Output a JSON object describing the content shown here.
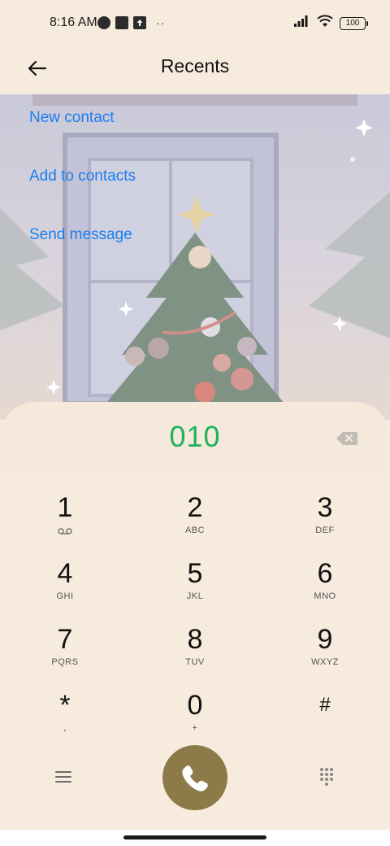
{
  "status_bar": {
    "time": "8:16 AM",
    "dots": "··",
    "battery": "100",
    "icons": [
      "app-icon",
      "notification-square-icon",
      "upload-icon",
      "signal-icon",
      "wifi-icon",
      "battery-icon"
    ]
  },
  "header": {
    "title": "Recents",
    "back_icon": "arrow-left-icon"
  },
  "actions": {
    "new_contact": "New contact",
    "add_to_contacts": "Add to contacts",
    "send_message": "Send message"
  },
  "dialer": {
    "number": "010",
    "delete_icon": "backspace-icon",
    "keys": [
      {
        "digit": "1",
        "letters": ""
      },
      {
        "digit": "2",
        "letters": "ABC"
      },
      {
        "digit": "3",
        "letters": "DEF"
      },
      {
        "digit": "4",
        "letters": "GHI"
      },
      {
        "digit": "5",
        "letters": "JKL"
      },
      {
        "digit": "6",
        "letters": "MNO"
      },
      {
        "digit": "7",
        "letters": "PQRS"
      },
      {
        "digit": "8",
        "letters": "TUV"
      },
      {
        "digit": "9",
        "letters": "WXYZ"
      },
      {
        "digit": "*",
        "letters": ","
      },
      {
        "digit": "0",
        "letters": "+"
      },
      {
        "digit": "#",
        "letters": ""
      }
    ],
    "call_icon": "phone-icon",
    "menu_icon": "menu-icon",
    "keypad_icon": "keypad-grid-icon"
  },
  "colors": {
    "background": "#f7ebde",
    "accent_link": "#1c7ef0",
    "dialed_number": "#1fb25a",
    "call_button": "#8c7a49"
  }
}
